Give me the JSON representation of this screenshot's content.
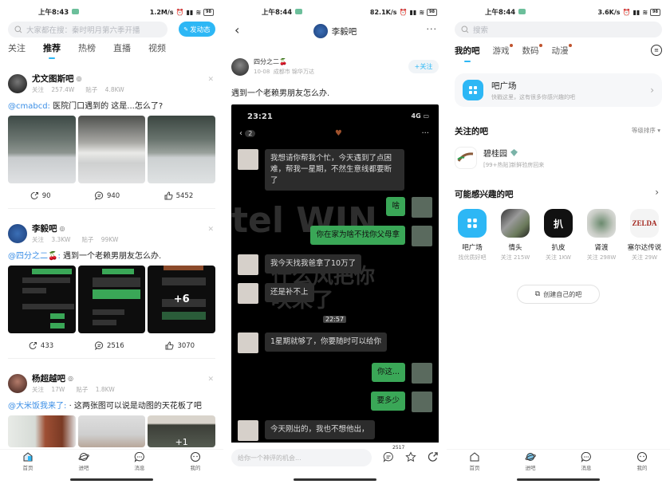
{
  "phone1": {
    "status": {
      "time": "上午8:43",
      "speed": "1.2M/s",
      "battery": "98"
    },
    "search": {
      "placeholder": "大家都在搜：秦时明月第六季开播"
    },
    "post_button": "发动态",
    "tabs": [
      {
        "label": "关注",
        "active": false
      },
      {
        "label": "推荐",
        "active": true
      },
      {
        "label": "热榜",
        "active": false
      },
      {
        "label": "直播",
        "active": false
      },
      {
        "label": "视频",
        "active": false
      }
    ],
    "posts": [
      {
        "forum": "尤文图斯吧",
        "follow_label": "关注",
        "follow": "257.4W",
        "posts_label": "贴子",
        "posts": "4.8KW",
        "mention": "@cmabcd:",
        "text": "医院门口遇到的 这是...怎么了?",
        "share": "90",
        "comments": "940",
        "likes": "5452"
      },
      {
        "forum": "李毅吧",
        "follow_label": "关注",
        "follow": "3.3KW",
        "posts_label": "贴子",
        "posts": "99KW",
        "mention": "@四分之二🍒:",
        "text": "遇到一个老赖男朋友怎么办.",
        "more_images": "+6",
        "share": "433",
        "comments": "2516",
        "likes": "3070"
      },
      {
        "forum": "杨超越吧",
        "follow_label": "关注",
        "follow": "17W",
        "posts_label": "贴子",
        "posts": "1.8KW",
        "mention": "@大米饭我来了:",
        "text": "· 这两张图可以说是动图的天花板了吧",
        "more_images": "+1"
      }
    ],
    "nav": [
      {
        "label": "首页",
        "icon": "home-icon"
      },
      {
        "label": "进吧",
        "icon": "planet-icon"
      },
      {
        "label": "消息",
        "icon": "message-icon"
      },
      {
        "label": "我的",
        "icon": "face-icon"
      }
    ]
  },
  "phone2": {
    "status": {
      "time": "上午8:44",
      "speed": "82.1K/s",
      "battery": "98"
    },
    "header_title": "李毅吧",
    "author": {
      "name": "四分之二🍒",
      "date": "10-08",
      "location": "成都市 锦华万达",
      "follow_button": "+关注"
    },
    "post_text": "遇到一个老赖男朋友怎么办.",
    "chat": {
      "time": "23:21",
      "signal": "4G",
      "back_count": "2",
      "watermark_1": "tel WIN",
      "watermark_2": "什么风把你",
      "watermark_3": "吹来了",
      "messages": [
        {
          "from": "them",
          "text": "我想请你帮我个忙，今天遇到了点困难，帮我一星期，不然生意线都要断了"
        },
        {
          "from": "me",
          "text": "啥"
        },
        {
          "from": "me",
          "text": "你在家为啥不找你父母拿"
        },
        {
          "from": "them",
          "text": "我今天找我爸拿了10万了"
        },
        {
          "from": "them",
          "text": "还是补不上"
        },
        {
          "timestamp": "22:57"
        },
        {
          "from": "them",
          "text": "1星期就够了，你要随时可以给你"
        },
        {
          "from": "me",
          "text": "你这..."
        },
        {
          "from": "me",
          "text": "要多少"
        },
        {
          "from": "them",
          "text": "今天刚出的，我也不想他出，"
        }
      ]
    },
    "comment_placeholder": "给你一个神评的机会...",
    "comment_count": "2517"
  },
  "phone3": {
    "status": {
      "time": "上午8:44",
      "speed": "3.6K/s",
      "battery": "98"
    },
    "search": {
      "placeholder": "搜索"
    },
    "tabs": [
      {
        "label": "我的吧",
        "active": true,
        "dot": false
      },
      {
        "label": "游戏",
        "active": false,
        "dot": true
      },
      {
        "label": "数码",
        "active": false,
        "dot": true
      },
      {
        "label": "动漫",
        "active": false,
        "dot": true
      }
    ],
    "plaza": {
      "title": "吧广场",
      "subtitle": "快戳这里，这有很多你感兴趣的吧"
    },
    "followed": {
      "title": "关注的吧",
      "sort": "等级排序",
      "items": [
        {
          "name": "碧桂园",
          "level": "9",
          "desc": "[99+热贴]新鲜验房回来"
        }
      ]
    },
    "interest": {
      "title": "可能感兴趣的吧",
      "items": [
        {
          "name": "吧广场",
          "sub": "找优质好吧"
        },
        {
          "name": "情头",
          "sub": "关注 215W"
        },
        {
          "name": "扒皮",
          "sub": "关注 1KW"
        },
        {
          "name": "肾渡",
          "sub": "关注 298W"
        },
        {
          "name": "塞尔达传说",
          "sub": "关注 29W"
        }
      ]
    },
    "create_button": "创建自己的吧",
    "nav": [
      {
        "label": "首页"
      },
      {
        "label": "进吧"
      },
      {
        "label": "消息"
      },
      {
        "label": "我的"
      }
    ]
  }
}
